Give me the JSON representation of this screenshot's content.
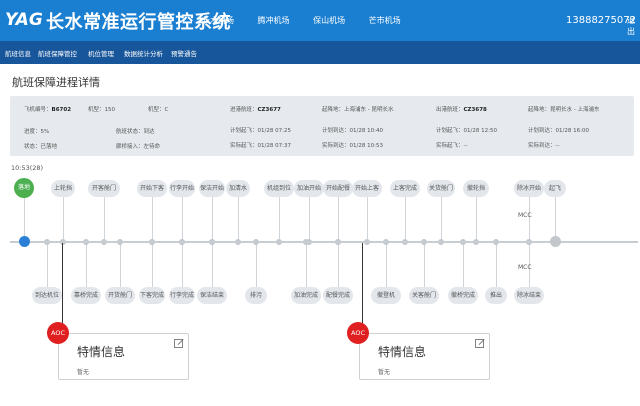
{
  "header": {
    "logo_text": "YAG",
    "title": "长水常准运行管控系统",
    "airports": [
      "长水机场",
      "腾冲机场",
      "保山机场",
      "芒市机场"
    ],
    "phone": "13888275072",
    "logout": "退出"
  },
  "nav": [
    "航班信息",
    "航班保障管控",
    "机位管理",
    "数据统计分析",
    "预警通告"
  ],
  "page_title": "航班保障进程详情",
  "info": {
    "plane_no_label": "飞机编号：",
    "plane_no": "B6702",
    "type_label": "机型：",
    "type": "150",
    "stand_label": "机型：",
    "stand": "C",
    "progress_label": "进度：",
    "progress": "5%",
    "flight_status_label": "航班状态：",
    "flight_status": "到达",
    "state_label": "状态：",
    "state": "已落地",
    "gate_label": "廊桥接入：",
    "gate": "左待命",
    "in_flight_label": "进港航班：",
    "in_flight": "CZ3677",
    "in_route_label": "起降地：",
    "in_route": "上海浦东 - 昆明长水",
    "in_plan_dep_label": "计划起飞：",
    "in_plan_dep": "01/28 07:25",
    "in_plan_arr_label": "计划到达：",
    "in_plan_arr": "01/28 10:40",
    "in_act_dep_label": "实际起飞：",
    "in_act_dep": "01/28 07:37",
    "in_act_arr_label": "实际到达：",
    "in_act_arr": "01/28 10:53",
    "out_flight_label": "出港航班：",
    "out_flight": "CZ3678",
    "out_route_label": "起降地：",
    "out_route": "昆明长水 - 上海浦东",
    "out_plan_dep_label": "计划起飞：",
    "out_plan_dep": "01/28 12:50",
    "out_plan_arr_label": "计划到达：",
    "out_plan_arr": "01/28 16:00",
    "out_act_dep_label": "实际起飞：",
    "out_act_dep": "--",
    "out_act_arr_label": "实际到达：",
    "out_act_arr": "--"
  },
  "timeline": {
    "time_label": "10:53(28)",
    "top_pills": [
      "落地",
      "上轮挡",
      "开客舱门",
      "开始下客",
      "行李开始",
      "保洁开始",
      "加清水",
      "机组到位",
      "加油开始",
      "开始配餐",
      "开始上客",
      "上客完成",
      "关货舱门",
      "撤轮挡",
      "除冰开始",
      "起飞"
    ],
    "bottom_pills": [
      "到达机位",
      "靠桥完成",
      "开货舱门",
      "下客完成",
      "行李完成",
      "保洁结束",
      "排污",
      "加油完成",
      "配餐完成",
      "撤登机",
      "关客舱门",
      "撤桥完成",
      "推出",
      "除冰结束"
    ],
    "mcc_label": "MCC"
  },
  "cards": [
    {
      "badge": "AOC",
      "title": "特情信息",
      "sub": "暂无"
    },
    {
      "badge": "AOC",
      "title": "特情信息",
      "sub": "暂无"
    }
  ]
}
